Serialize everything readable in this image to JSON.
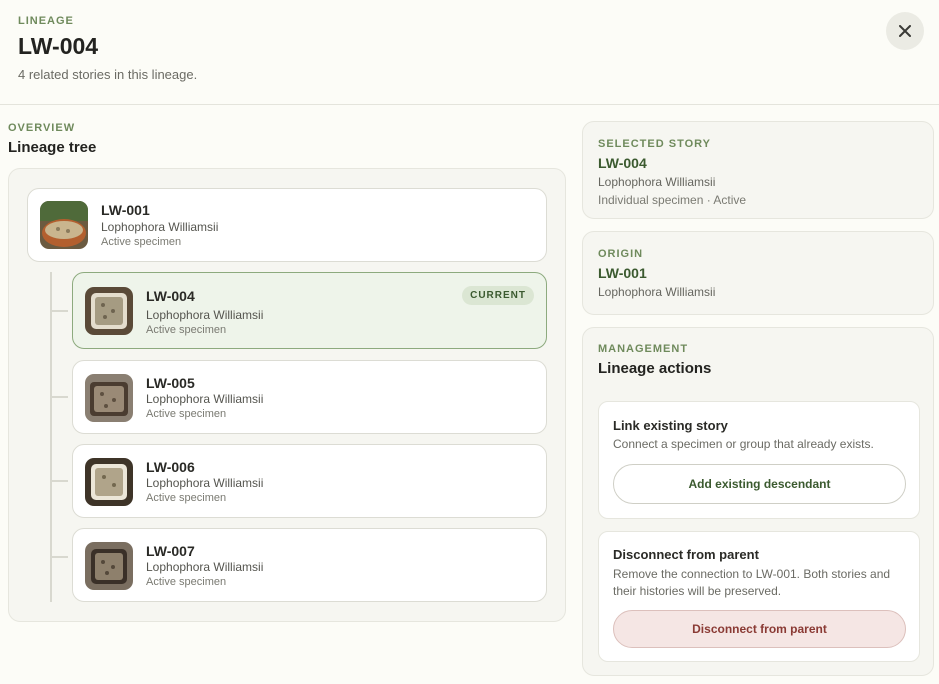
{
  "header": {
    "eyebrow": "LINEAGE",
    "title": "LW-004",
    "subtitle": "4 related stories in this lineage."
  },
  "overview": {
    "eyebrow": "OVERVIEW",
    "title": "Lineage tree"
  },
  "tree": {
    "root": {
      "id": "LW-001",
      "species": "Lophophora Williamsii",
      "status": "Active specimen"
    },
    "children": [
      {
        "id": "LW-004",
        "species": "Lophophora Williamsii",
        "status": "Active specimen",
        "badge": "CURRENT"
      },
      {
        "id": "LW-005",
        "species": "Lophophora Williamsii",
        "status": "Active specimen"
      },
      {
        "id": "LW-006",
        "species": "Lophophora Williamsii",
        "status": "Active specimen"
      },
      {
        "id": "LW-007",
        "species": "Lophophora Williamsii",
        "status": "Active specimen"
      }
    ]
  },
  "selected": {
    "eyebrow": "SELECTED STORY",
    "id": "LW-004",
    "species": "Lophophora Williamsii",
    "meta": "Individual specimen · Active"
  },
  "origin": {
    "eyebrow": "ORIGIN",
    "id": "LW-001",
    "species": "Lophophora Williamsii"
  },
  "management": {
    "eyebrow": "MANAGEMENT",
    "title": "Lineage actions",
    "link": {
      "title": "Link existing story",
      "desc": "Connect a specimen or group that already exists.",
      "button": "Add existing descendant"
    },
    "disconnect": {
      "title": "Disconnect from parent",
      "desc": "Remove the connection to LW-001. Both stories and their histories will be preserved.",
      "button": "Disconnect from parent"
    }
  },
  "colors": {
    "accent": "#6f8a5c",
    "current_bg": "#eef4ea",
    "danger_bg": "#f5e6e4"
  }
}
